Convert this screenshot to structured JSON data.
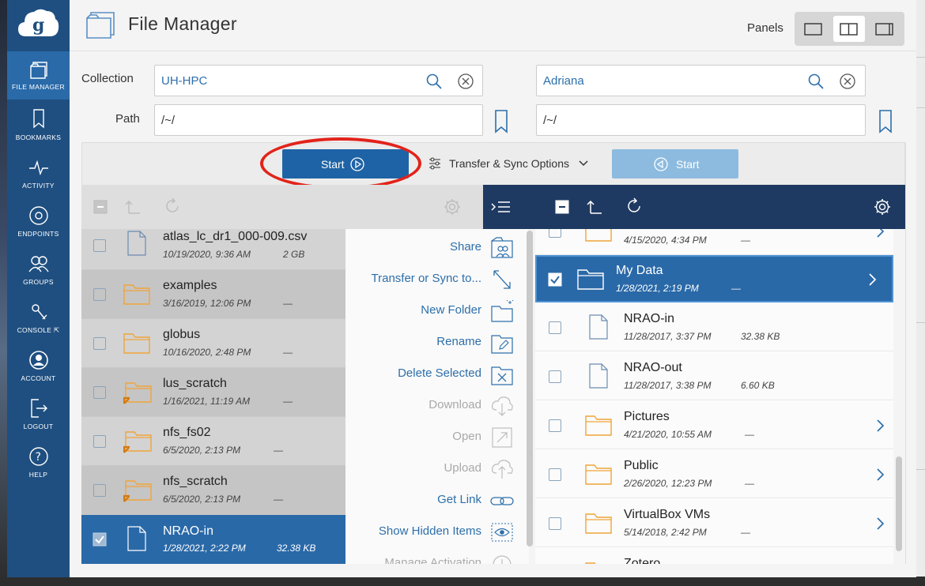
{
  "header": {
    "title": "File Manager",
    "panels_label": "Panels"
  },
  "sidebar": {
    "items": [
      {
        "label": "FILE MANAGER",
        "icon": "file-manager-icon",
        "active": true
      },
      {
        "label": "BOOKMARKS",
        "icon": "bookmark-icon"
      },
      {
        "label": "ACTIVITY",
        "icon": "activity-icon"
      },
      {
        "label": "ENDPOINTS",
        "icon": "endpoints-icon"
      },
      {
        "label": "GROUPS",
        "icon": "groups-icon"
      },
      {
        "label": "CONSOLE",
        "icon": "console-icon"
      },
      {
        "label": "ACCOUNT",
        "icon": "account-icon"
      },
      {
        "label": "LOGOUT",
        "icon": "logout-icon"
      },
      {
        "label": "HELP",
        "icon": "help-icon"
      }
    ]
  },
  "form": {
    "collection_label": "Collection",
    "path_label": "Path",
    "left": {
      "collection": "UH-HPC",
      "path": "/~/"
    },
    "right": {
      "collection": "Adriana",
      "path": "/~/"
    }
  },
  "transfer": {
    "start_label": "Start",
    "options_label": "Transfer & Sync Options"
  },
  "left_files": [
    {
      "name": "atlas_lc_dr1_000-009.csv",
      "date": "10/19/2020, 9:36 AM",
      "size": "2 GB",
      "type": "file"
    },
    {
      "name": "examples",
      "date": "3/16/2019, 12:06 PM",
      "size": "—",
      "type": "folder"
    },
    {
      "name": "globus",
      "date": "10/16/2020, 2:48 PM",
      "size": "—",
      "type": "folder"
    },
    {
      "name": "lus_scratch",
      "date": "1/16/2021, 11:19 AM",
      "size": "—",
      "type": "link"
    },
    {
      "name": "nfs_fs02",
      "date": "6/5/2020, 2:13 PM",
      "size": "—",
      "type": "link"
    },
    {
      "name": "nfs_scratch",
      "date": "6/5/2020, 2:13 PM",
      "size": "—",
      "type": "link"
    },
    {
      "name": "NRAO-in",
      "date": "1/28/2021, 2:22 PM",
      "size": "32.38 KB",
      "type": "file",
      "selected": true
    }
  ],
  "actions": [
    {
      "label": "Share",
      "enabled": true,
      "icon": "share-icon"
    },
    {
      "label": "Transfer or Sync to...",
      "enabled": true,
      "icon": "transfer-icon"
    },
    {
      "label": "New Folder",
      "enabled": true,
      "icon": "new-folder-icon"
    },
    {
      "label": "Rename",
      "enabled": true,
      "icon": "rename-icon"
    },
    {
      "label": "Delete Selected",
      "enabled": true,
      "icon": "delete-icon"
    },
    {
      "label": "Download",
      "enabled": false,
      "icon": "download-icon"
    },
    {
      "label": "Open",
      "enabled": false,
      "icon": "open-icon"
    },
    {
      "label": "Upload",
      "enabled": false,
      "icon": "upload-icon"
    },
    {
      "label": "Get Link",
      "enabled": true,
      "icon": "link-icon"
    },
    {
      "label": "Show Hidden Items",
      "enabled": true,
      "icon": "eye-icon"
    },
    {
      "label": "Manage Activation",
      "enabled": false,
      "icon": "power-icon"
    }
  ],
  "right_files": [
    {
      "name": "",
      "date": "4/15/2020, 4:34 PM",
      "size": "—",
      "type": "folder",
      "chevron": true
    },
    {
      "name": "My Data",
      "date": "1/28/2021, 2:19 PM",
      "size": "—",
      "type": "folder",
      "chevron": true,
      "selected": true
    },
    {
      "name": "NRAO-in",
      "date": "11/28/2017, 3:37 PM",
      "size": "32.38 KB",
      "type": "file"
    },
    {
      "name": "NRAO-out",
      "date": "11/28/2017, 3:38 PM",
      "size": "6.60 KB",
      "type": "file"
    },
    {
      "name": "Pictures",
      "date": "4/21/2020, 10:55 AM",
      "size": "—",
      "type": "folder",
      "chevron": true
    },
    {
      "name": "Public",
      "date": "2/26/2020, 12:23 PM",
      "size": "—",
      "type": "folder",
      "chevron": true
    },
    {
      "name": "VirtualBox VMs",
      "date": "5/14/2018, 2:42 PM",
      "size": "—",
      "type": "folder",
      "chevron": true
    },
    {
      "name": "Zotero",
      "date": "",
      "size": "",
      "type": "folder"
    }
  ],
  "colors": {
    "sidebar": "#1f4f80",
    "accent": "#1e63a5",
    "folder": "#f0a53a",
    "selected_row": "#2a69a8",
    "toolbar_dark": "#1f3a62"
  }
}
